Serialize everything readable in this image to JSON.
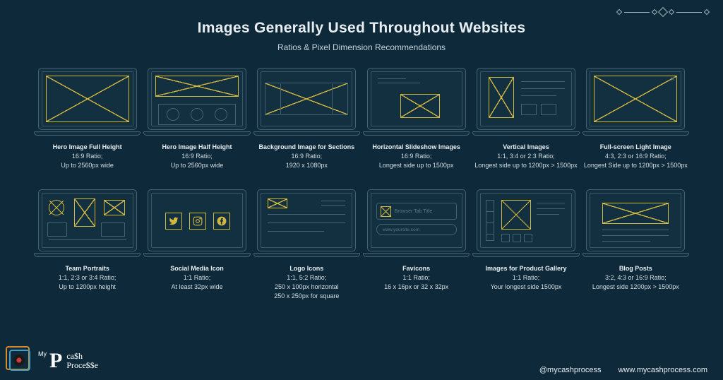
{
  "header": {
    "title": "Images Generally Used Throughout Websites",
    "subtitle": "Ratios & Pixel Dimension Recommendations"
  },
  "items": [
    {
      "name": "Hero Image Full Height",
      "ratio": "16:9 Ratio;",
      "dim": "Up to 2560px wide"
    },
    {
      "name": "Hero Image Half Height",
      "ratio": "16:9 Ratio;",
      "dim": "Up to 2560px wide"
    },
    {
      "name": "Background Image for Sections",
      "ratio": "16:9 Ratio;",
      "dim": "1920 x 1080px"
    },
    {
      "name": "Horizontal Slideshow Images",
      "ratio": "16:9 Ratio;",
      "dim": "Longest side up to 1500px"
    },
    {
      "name": "Vertical Images",
      "ratio": "1:1, 3:4 or 2:3 Ratio;",
      "dim": "Longest side up to 1200px > 1500px"
    },
    {
      "name": "Full-screen Light Image",
      "ratio": "4:3, 2:3 or 16:9 Ratio;",
      "dim": "Longest Side up to 1200px > 1500px"
    },
    {
      "name": "Team Portraits",
      "ratio": "1:1, 2:3 or 3:4 Ratio;",
      "dim": "Up to 1200px height"
    },
    {
      "name": "Social Media Icon",
      "ratio": "1:1 Ratio;",
      "dim": "At least 32px wide"
    },
    {
      "name": "Logo Icons",
      "ratio": "1:1, 5:2 Ratio;",
      "dim": "250 x 100px horizontal",
      "dim2": "250 x 250px for square"
    },
    {
      "name": "Favicons",
      "ratio": "1:1 Ratio;",
      "dim": "16 x 16px or 32 x 32px"
    },
    {
      "name": "Images for Product Gallery",
      "ratio": "1:1 Ratio;",
      "dim": "Your longest side 1500px"
    },
    {
      "name": "Blog Posts",
      "ratio": "3:2, 4:3 or 16:9 Ratio;",
      "dim": "Longest side 1200px > 1500px"
    }
  ],
  "favicon_tab_text": "Browser Tab Title",
  "favicon_url_text": "www.yoursite.com",
  "footer": {
    "handle": "@mycashprocess",
    "site": "www.mycashprocess.com"
  },
  "brand": {
    "my": "My",
    "line1": "ca$h",
    "line2": "Proce$$e"
  },
  "social_icons": [
    "twitter-icon",
    "instagram-icon",
    "facebook-icon"
  ]
}
